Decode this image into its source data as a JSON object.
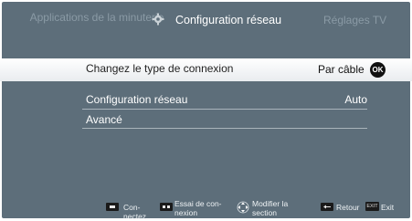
{
  "header": {
    "left_tab": "Applications de la minuterie",
    "center_tab": "Configuration réseau",
    "right_tab": "Réglages TV"
  },
  "menu": {
    "items": [
      {
        "label": "Changez le type de connexion",
        "value": "Par câble",
        "ok_label": "OK"
      },
      {
        "label": "Configuration réseau",
        "value": "Auto"
      },
      {
        "label": "Avancé",
        "value": ""
      }
    ]
  },
  "footer": {
    "connect": "Con-\nnectez",
    "test": "Essai de con-\nnexion",
    "modify": "Modifier la\nsection",
    "back": "Retour",
    "exit_key": "EXIT",
    "exit": "Exit"
  }
}
